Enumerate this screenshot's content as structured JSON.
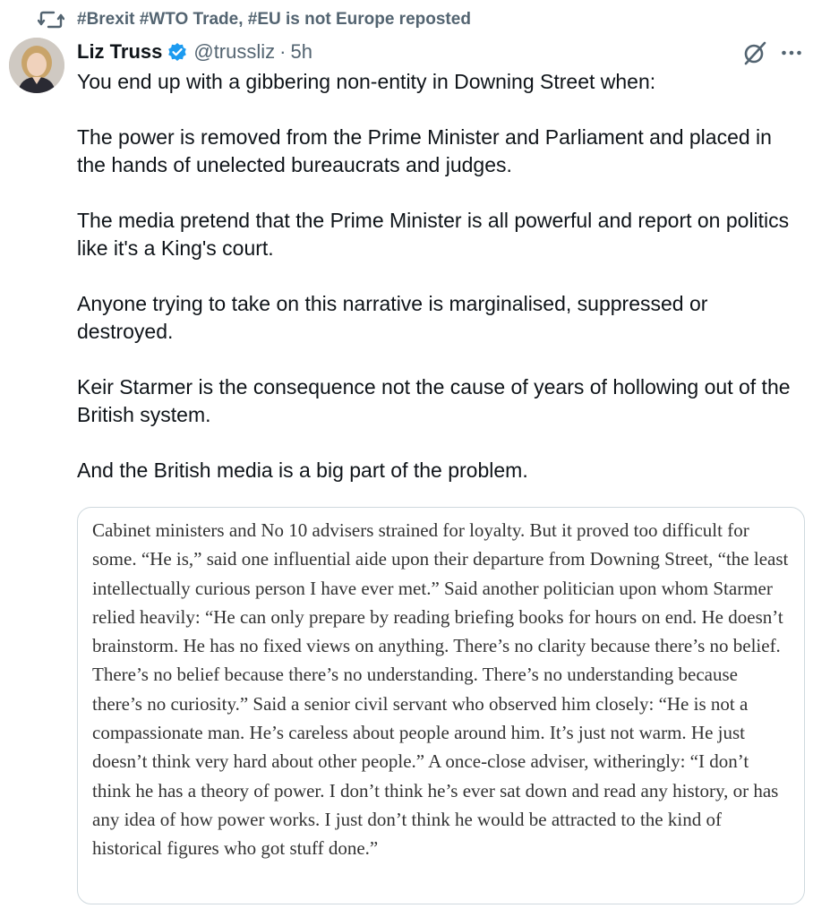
{
  "repost": {
    "icon": "repost-icon",
    "label": "#Brexit #WTO Trade, #EU is not Europe reposted"
  },
  "author": {
    "name": "Liz Truss",
    "handle": "@trussliz",
    "separator": "·",
    "time": "5h",
    "verified_icon": "verified-badge-icon",
    "verified_color": "#1d9bf0"
  },
  "actions": {
    "grok_icon": "grok-icon",
    "more_icon": "more-options-icon"
  },
  "tweet": {
    "paragraphs": [
      "You end up with a gibbering non-entity in Downing Street when:",
      "The power is removed from the Prime Minister and Parliament and placed in the hands of unelected bureaucrats and judges.",
      "The media pretend that the Prime Minister is all powerful and report on politics like it's a King's court.",
      "Anyone trying to take on this narrative is marginalised, suppressed or destroyed.",
      "Keir Starmer is the consequence not the cause of years of hollowing out of the British system.",
      "And the British media is a big part of the problem."
    ]
  },
  "quote": {
    "text": "Cabinet ministers and No 10 advisers strained for loyalty. But it proved too difficult for some. “He is,” said one influential aide upon their departure from Downing Street, “the least intellectually curious person I have ever met.” Said another politician upon whom Starmer relied heavily: “He can only prepare by reading briefing books for hours on end. He doesn’t brainstorm. He has no fixed views on anything. There’s no clarity because there’s no belief. There’s no belief because there’s no understanding. There’s no understanding because there’s no curiosity.” Said a senior civil servant who observed him closely: “He is not a compassionate man. He’s careless about people around him. It’s just not warm. He just doesn’t think very hard about other people.” A once-close adviser, witheringly: “I don’t think he has a theory of power. I don’t think he’s ever sat down and read any history, or has any idea of how power works. I just don’t think he would be attracted to the kind of historical figures who got stuff done.”"
  },
  "colors": {
    "text": "#0f1419",
    "secondary": "#536471",
    "quote_text": "#333333",
    "border": "#cfd9de",
    "verified": "#1d9bf0"
  }
}
